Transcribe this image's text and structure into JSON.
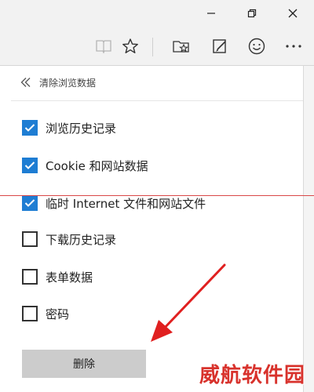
{
  "panel": {
    "title": "清除浏览数据",
    "options": [
      {
        "label": "浏览历史记录",
        "checked": true
      },
      {
        "label": "Cookie 和网站数据",
        "checked": true
      },
      {
        "label": "临时 Internet 文件和网站文件",
        "checked": true
      },
      {
        "label": "下载历史记录",
        "checked": false
      },
      {
        "label": "表单数据",
        "checked": false
      },
      {
        "label": "密码",
        "checked": false
      }
    ],
    "delete_label": "删除"
  },
  "watermark": "威航软件园",
  "colors": {
    "accent": "#1e7dd3",
    "button_bg": "#cccccc",
    "annotation": "#d94848",
    "watermark": "#d8322c"
  },
  "icons": [
    "minimize-icon",
    "maximize-icon",
    "close-icon",
    "reading-view-icon",
    "favorite-star-icon",
    "favorites-hub-icon",
    "web-note-icon",
    "feedback-smiley-icon",
    "more-icon",
    "back-double-chevron-icon",
    "checkmark-icon"
  ]
}
